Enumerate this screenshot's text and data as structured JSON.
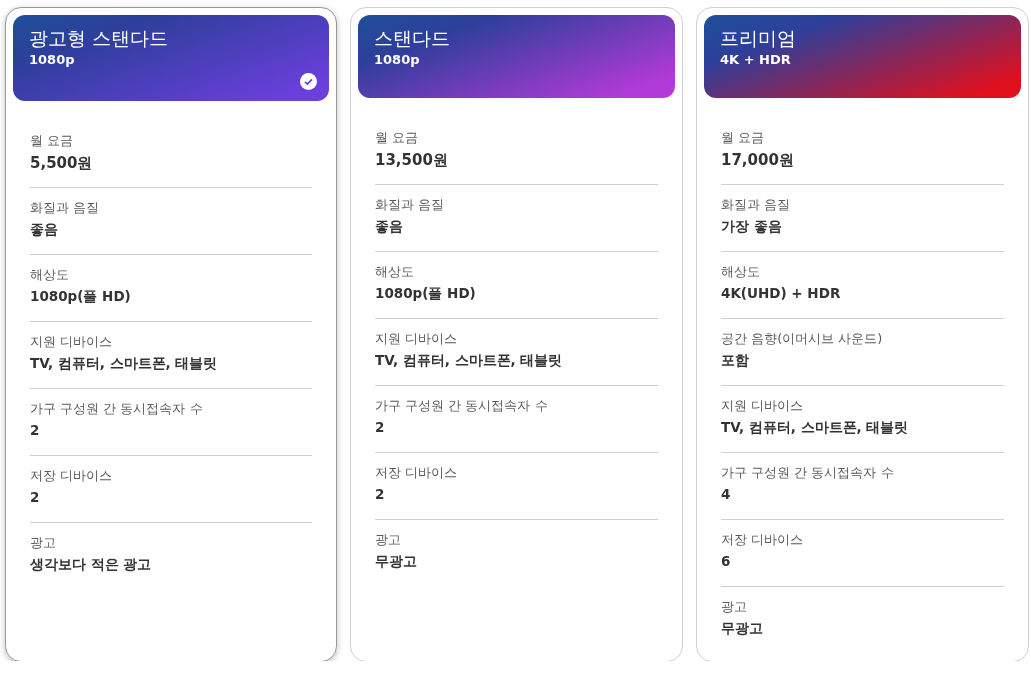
{
  "plans": [
    {
      "name": "광고형 스탠다드",
      "quality": "1080p",
      "selected": true,
      "color": "#6a3fdc",
      "features": [
        {
          "label": "월 요금",
          "value": "5,500원",
          "kind": "price"
        },
        {
          "label": "화질과 음질",
          "value": "좋음",
          "kind": "plain"
        },
        {
          "label": "해상도",
          "value": "1080p(풀 HD)",
          "kind": "plain"
        },
        {
          "label": "지원 디바이스",
          "value": "TV, 컴퓨터, 스마트폰, 태블릿",
          "kind": "plain"
        },
        {
          "label": "가구 구성원 간 동시접속자 수",
          "value": "2",
          "kind": "plain"
        },
        {
          "label": "저장 디바이스",
          "value": "2",
          "kind": "plain"
        },
        {
          "label": "광고",
          "value": "생각보다 적은 광고",
          "kind": "plain"
        }
      ]
    },
    {
      "name": "스탠다드",
      "quality": "1080p",
      "selected": false,
      "color": "#b43ad8",
      "features": [
        {
          "label": "월 요금",
          "value": "13,500원",
          "kind": "price"
        },
        {
          "label": "화질과 음질",
          "value": "좋음",
          "kind": "plain"
        },
        {
          "label": "해상도",
          "value": "1080p(풀 HD)",
          "kind": "plain"
        },
        {
          "label": "지원 디바이스",
          "value": "TV, 컴퓨터, 스마트폰, 태블릿",
          "kind": "plain"
        },
        {
          "label": "가구 구성원 간 동시접속자 수",
          "value": "2",
          "kind": "plain"
        },
        {
          "label": "저장 디바이스",
          "value": "2",
          "kind": "plain"
        },
        {
          "label": "광고",
          "value": "무광고",
          "kind": "plain"
        }
      ]
    },
    {
      "name": "프리미엄",
      "quality": "4K + HDR",
      "selected": false,
      "color": "#e0101c",
      "features": [
        {
          "label": "월 요금",
          "value": "17,000원",
          "kind": "price"
        },
        {
          "label": "화질과 음질",
          "value": "가장 좋음",
          "kind": "plain"
        },
        {
          "label": "해상도",
          "value": "4K(UHD) + HDR",
          "kind": "plain"
        },
        {
          "label": "공간 음향(이머시브 사운드)",
          "value": "포함",
          "kind": "plain"
        },
        {
          "label": "지원 디바이스",
          "value": "TV, 컴퓨터, 스마트폰, 태블릿",
          "kind": "plain"
        },
        {
          "label": "가구 구성원 간 동시접속자 수",
          "value": "4",
          "kind": "plain"
        },
        {
          "label": "저장 디바이스",
          "value": "6",
          "kind": "plain"
        },
        {
          "label": "광고",
          "value": "무광고",
          "kind": "plain"
        }
      ]
    }
  ]
}
